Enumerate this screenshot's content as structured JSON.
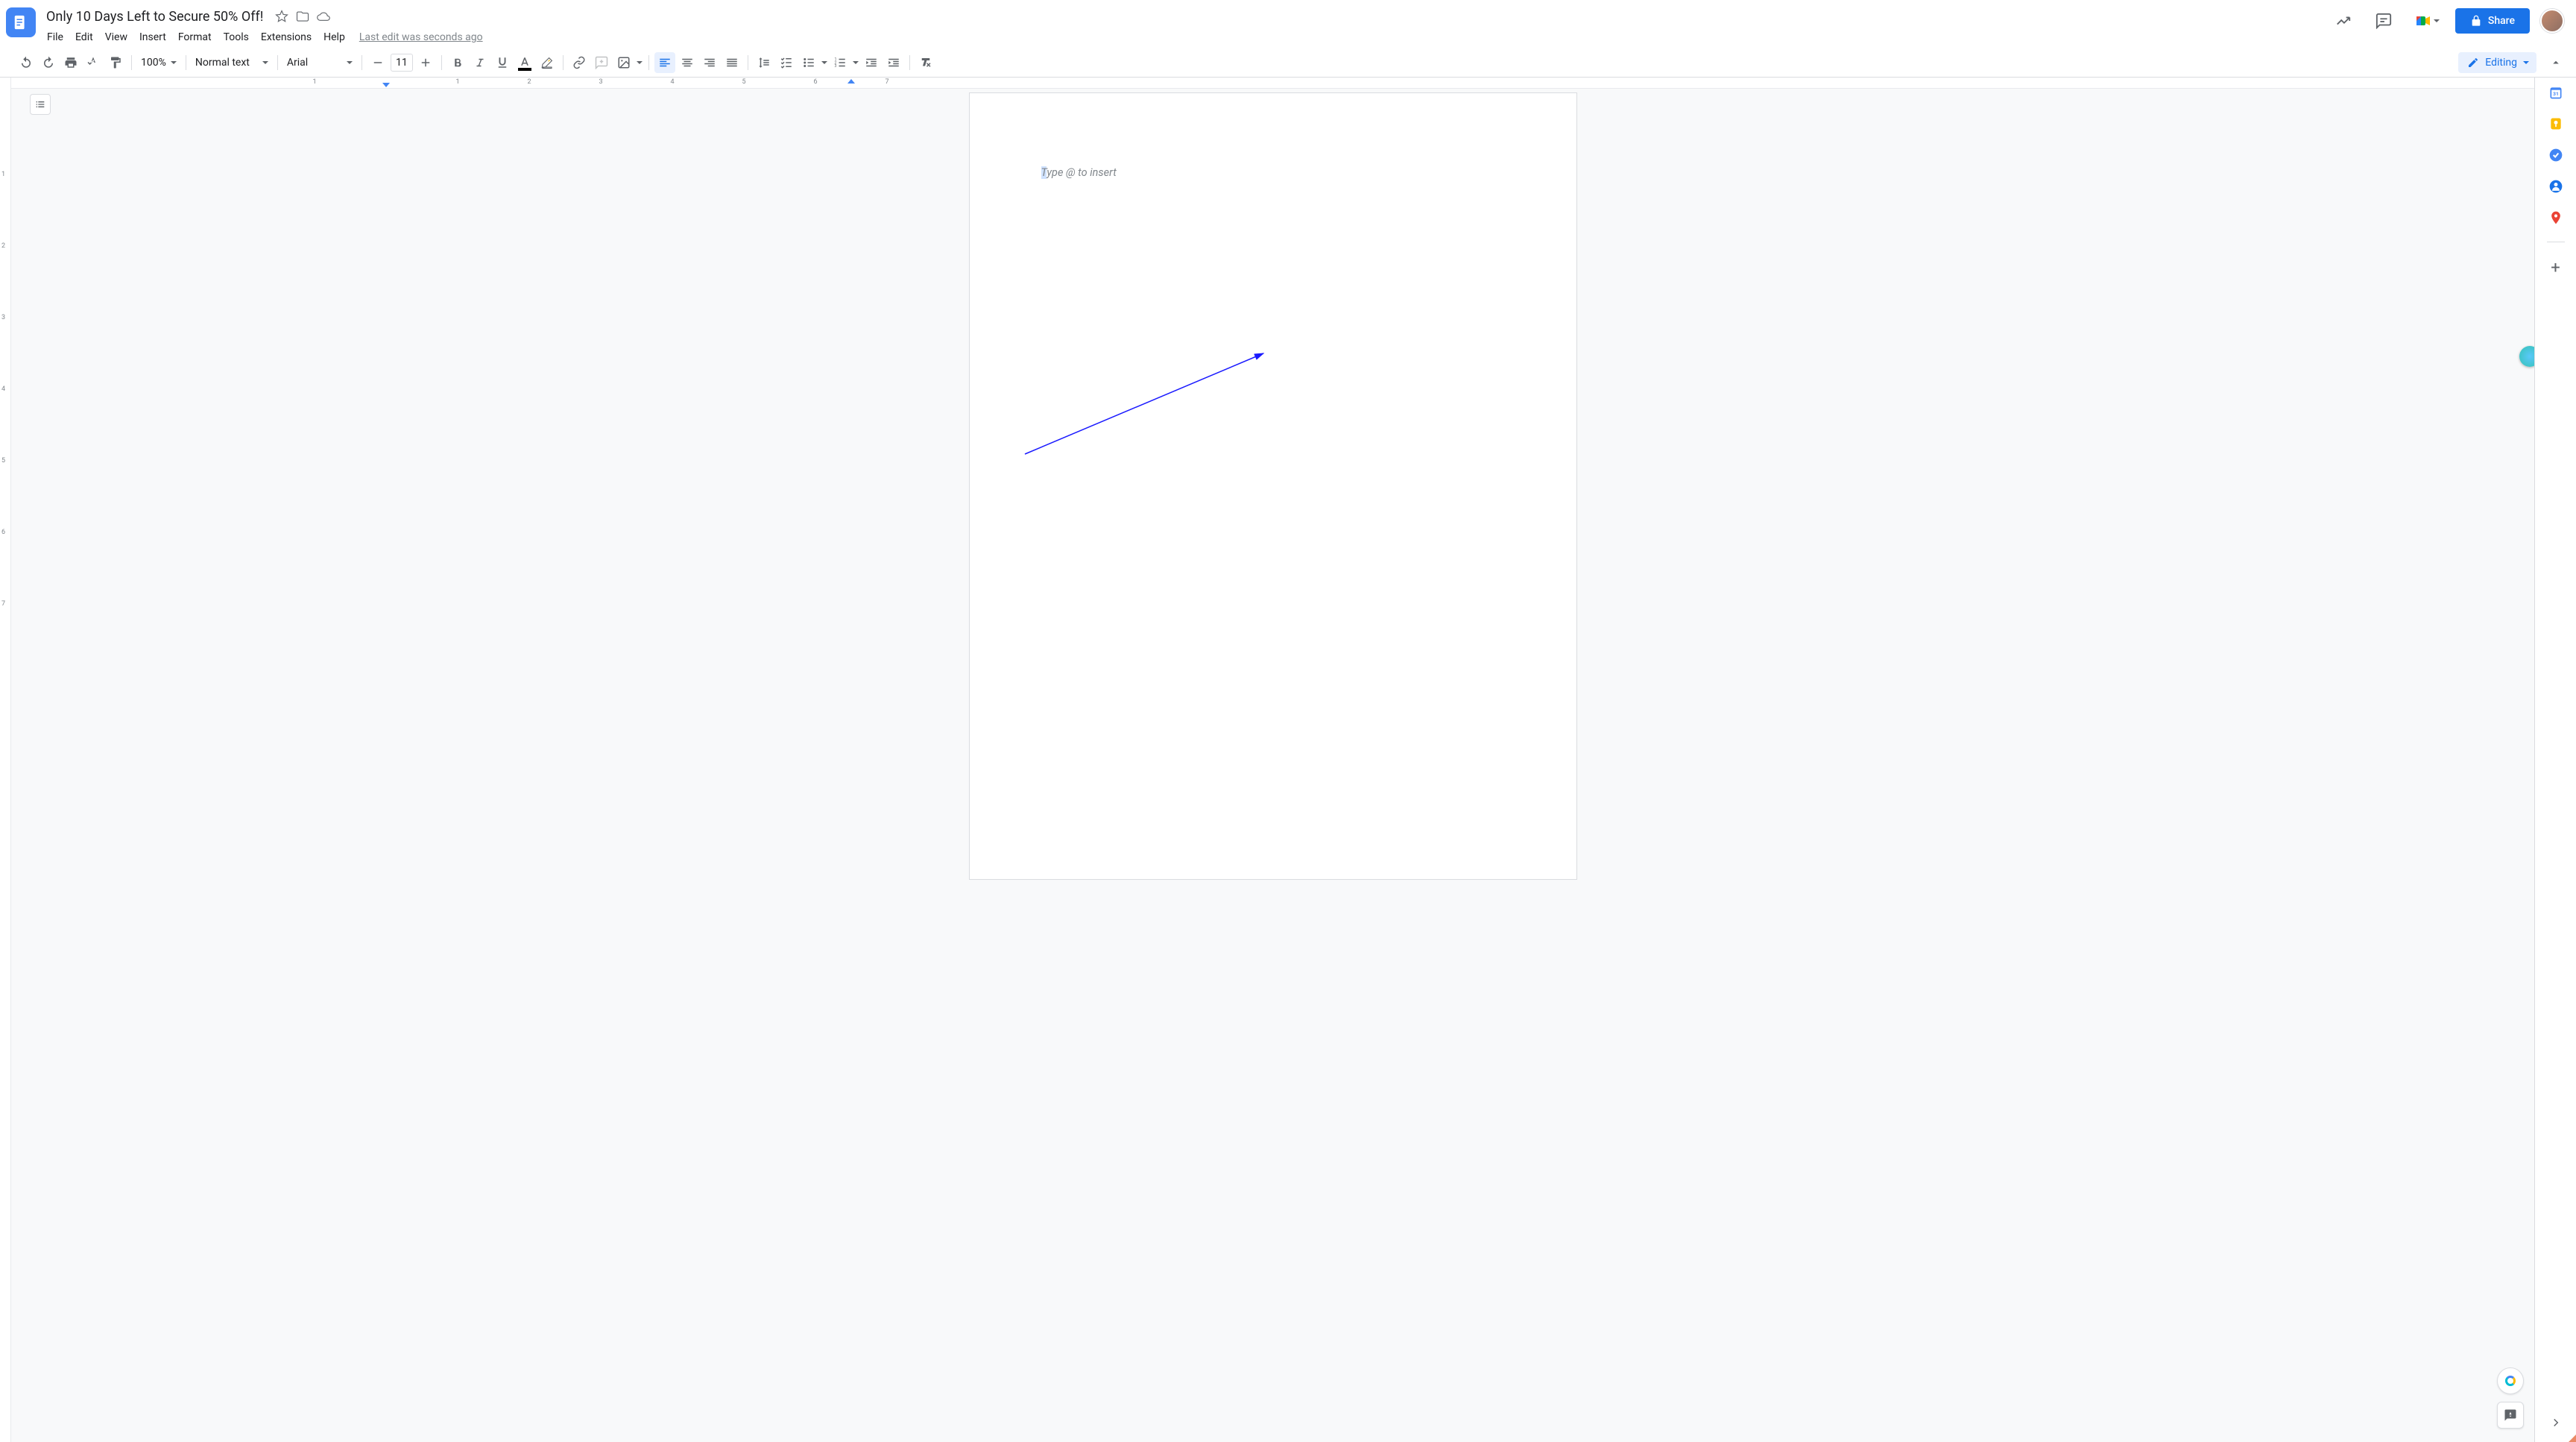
{
  "header": {
    "doc_title": "Only 10 Days Left to Secure 50% Off!",
    "last_edit": "Last edit was seconds ago",
    "share_label": "Share"
  },
  "menubar": {
    "items": [
      "File",
      "Edit",
      "View",
      "Insert",
      "Format",
      "Tools",
      "Extensions",
      "Help"
    ]
  },
  "toolbar": {
    "zoom": "100%",
    "style": "Normal text",
    "font": "Arial",
    "font_size": "11",
    "mode_label": "Editing"
  },
  "ruler": {
    "h_numbers": [
      1,
      1,
      2,
      3,
      4,
      5,
      6,
      7
    ],
    "v_numbers": [
      1,
      2,
      3,
      4,
      5,
      6,
      7
    ]
  },
  "document": {
    "placeholder_prefix": "T",
    "placeholder_rest": "ype @ to insert"
  },
  "sidepanel": {
    "apps": [
      "calendar",
      "keep",
      "tasks",
      "contacts",
      "maps"
    ]
  }
}
